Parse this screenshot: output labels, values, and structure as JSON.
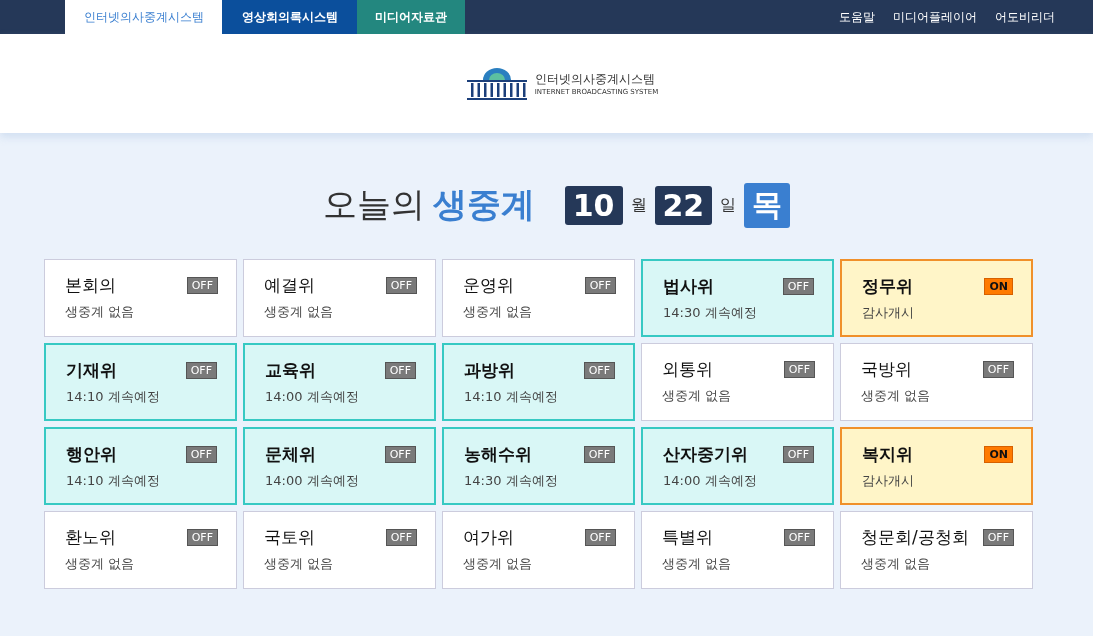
{
  "top_tabs": [
    {
      "label": "인터넷의사중계시스템",
      "selected": true,
      "kind": "home"
    },
    {
      "label": "영상회의록시스템",
      "selected": false,
      "kind": "blue"
    },
    {
      "label": "미디어자료관",
      "selected": false,
      "kind": "teal"
    }
  ],
  "top_links": [
    "도움말",
    "미디어플레이어",
    "어도비리더"
  ],
  "logo": {
    "title": "인터넷의사중계시스템",
    "subtitle": "INTERNET BROADCASTING SYSTEM"
  },
  "heading": {
    "prefix": "오늘의",
    "highlight": "생중계",
    "month": "10",
    "month_unit": "월",
    "day": "22",
    "day_unit": "일",
    "weekday": "목"
  },
  "committees": [
    {
      "name": "본회의",
      "status": "생중계 없음",
      "badge": "OFF",
      "kind": "none"
    },
    {
      "name": "예결위",
      "status": "생중계 없음",
      "badge": "OFF",
      "kind": "none"
    },
    {
      "name": "운영위",
      "status": "생중계 없음",
      "badge": "OFF",
      "kind": "none"
    },
    {
      "name": "법사위",
      "status": "14:30 계속예정",
      "badge": "OFF",
      "kind": "scheduled"
    },
    {
      "name": "정무위",
      "status": "감사개시",
      "badge": "ON",
      "kind": "live"
    },
    {
      "name": "기재위",
      "status": "14:10 계속예정",
      "badge": "OFF",
      "kind": "scheduled"
    },
    {
      "name": "교육위",
      "status": "14:00 계속예정",
      "badge": "OFF",
      "kind": "scheduled"
    },
    {
      "name": "과방위",
      "status": "14:10 계속예정",
      "badge": "OFF",
      "kind": "scheduled"
    },
    {
      "name": "외통위",
      "status": "생중계 없음",
      "badge": "OFF",
      "kind": "none"
    },
    {
      "name": "국방위",
      "status": "생중계 없음",
      "badge": "OFF",
      "kind": "none"
    },
    {
      "name": "행안위",
      "status": "14:10 계속예정",
      "badge": "OFF",
      "kind": "scheduled"
    },
    {
      "name": "문체위",
      "status": "14:00 계속예정",
      "badge": "OFF",
      "kind": "scheduled"
    },
    {
      "name": "농해수위",
      "status": "14:30 계속예정",
      "badge": "OFF",
      "kind": "scheduled"
    },
    {
      "name": "산자중기위",
      "status": "14:00 계속예정",
      "badge": "OFF",
      "kind": "scheduled"
    },
    {
      "name": "복지위",
      "status": "감사개시",
      "badge": "ON",
      "kind": "live"
    },
    {
      "name": "환노위",
      "status": "생중계 없음",
      "badge": "OFF",
      "kind": "none"
    },
    {
      "name": "국토위",
      "status": "생중계 없음",
      "badge": "OFF",
      "kind": "none"
    },
    {
      "name": "여가위",
      "status": "생중계 없음",
      "badge": "OFF",
      "kind": "none"
    },
    {
      "name": "특별위",
      "status": "생중계 없음",
      "badge": "OFF",
      "kind": "none"
    },
    {
      "name": "청문회/공청회",
      "status": "생중계 없음",
      "badge": "OFF",
      "kind": "none"
    }
  ]
}
